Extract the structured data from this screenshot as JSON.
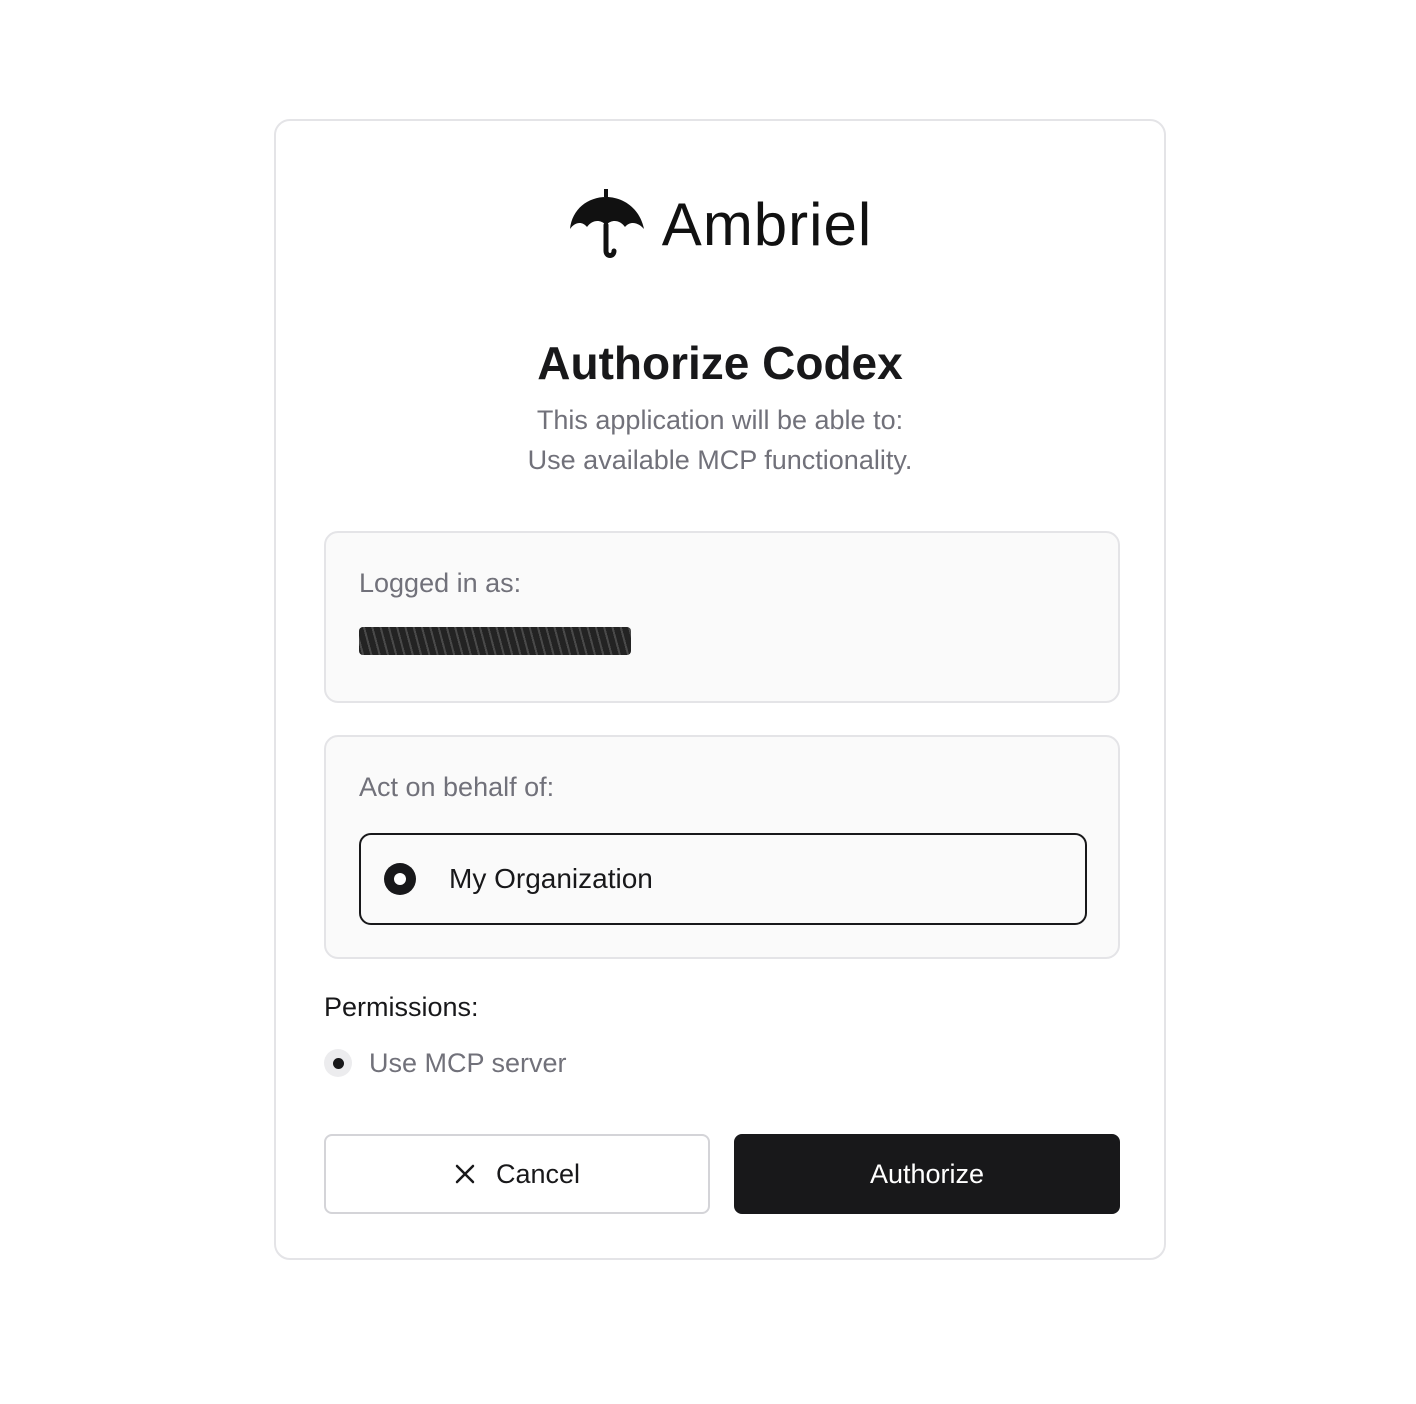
{
  "brand": {
    "name": "Ambriel",
    "logo_icon": "umbrella-icon"
  },
  "dialog": {
    "title": "Authorize Codex",
    "subtitle_line1": "This application will be able to:",
    "subtitle_line2": "Use available MCP functionality."
  },
  "login": {
    "label": "Logged in as:",
    "email": "[redacted]"
  },
  "org": {
    "label": "Act on behalf of:",
    "options": [
      {
        "label": "My Organization",
        "selected": true
      }
    ]
  },
  "permissions": {
    "title": "Permissions:",
    "items": [
      {
        "label": "Use MCP server"
      }
    ]
  },
  "actions": {
    "cancel_label": "Cancel",
    "cancel_icon": "close-icon",
    "authorize_label": "Authorize"
  },
  "colors": {
    "primary": "#18181a",
    "muted_text": "#71717a",
    "border": "#e4e4e7",
    "panel_bg": "#fafafa"
  }
}
